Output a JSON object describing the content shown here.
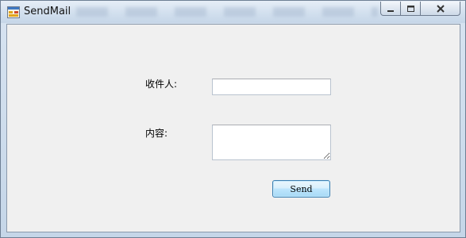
{
  "window": {
    "title": "SendMail",
    "controls": {
      "minimize": "minimize",
      "maximize": "maximize",
      "close": "close"
    }
  },
  "form": {
    "recipient_label": "收件人:",
    "recipient_value": "",
    "content_label": "内容:",
    "content_value": "",
    "send_label": "Send"
  },
  "icons": {
    "app": "app-window-icon",
    "minimize": "minimize-icon",
    "maximize": "maximize-icon",
    "close": "close-icon"
  }
}
